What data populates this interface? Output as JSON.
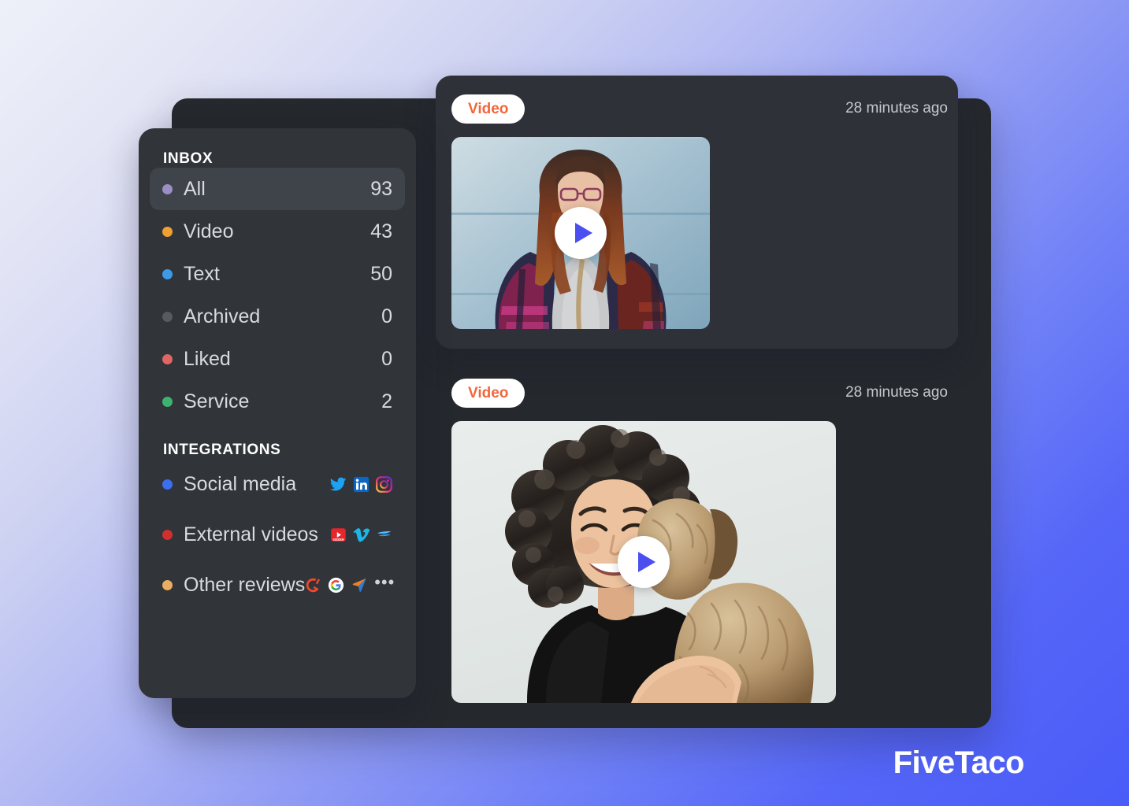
{
  "brand": {
    "name": "FiveTaco"
  },
  "sidebar": {
    "inbox_title": "INBOX",
    "integrations_title": "INTEGRATIONS",
    "inbox_items": [
      {
        "label": "All",
        "count": "93",
        "color": "#9b8ec4",
        "active": true
      },
      {
        "label": "Video",
        "count": "43",
        "color": "#f0a030",
        "active": false
      },
      {
        "label": "Text",
        "count": "50",
        "color": "#3d9ae8",
        "active": false
      },
      {
        "label": "Archived",
        "count": "0",
        "color": "#565b61",
        "active": false
      },
      {
        "label": "Liked",
        "count": "0",
        "color": "#e06565",
        "active": false
      },
      {
        "label": "Service",
        "count": "2",
        "color": "#3cb371",
        "active": false
      }
    ],
    "integration_items": [
      {
        "label": "Social media",
        "color": "#3b6ff0",
        "icons": [
          "twitter-icon",
          "linkedin-icon",
          "instagram-icon"
        ]
      },
      {
        "label": "External videos",
        "color": "#d03030",
        "icons": [
          "youtube-icon",
          "vimeo-icon",
          "wistia-icon"
        ]
      },
      {
        "label": "Other reviews",
        "color": "#eaad62",
        "icons": [
          "g2-icon",
          "google-icon",
          "navigation-arrow-icon",
          "ellipsis-icon"
        ]
      }
    ]
  },
  "feed": {
    "items": [
      {
        "badge": "Video",
        "timestamp": "28 minutes ago",
        "thumbnail_alt": "Woman with long reddish hair and glasses in grey sweater against blue wall",
        "play_icon": "play-icon"
      },
      {
        "badge": "Video",
        "timestamp": "28 minutes ago",
        "thumbnail_alt": "Smiling woman with curly dark hair holding a tan fluffy dog",
        "play_icon": "play-icon"
      }
    ]
  },
  "colors": {
    "accent": "#4b4ff0",
    "badge_text": "#f4663a",
    "panel_back": "#25282d",
    "panel_card": "#2e3137",
    "panel_sidebar": "#313438",
    "active_row": "#3f434a"
  }
}
